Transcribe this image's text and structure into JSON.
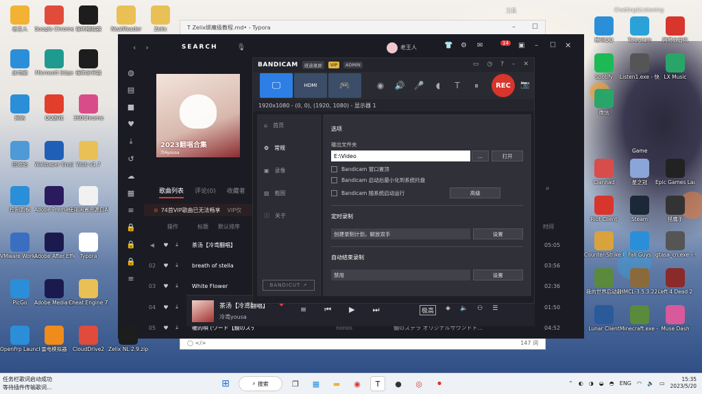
{
  "desktop": {
    "left_icons": [
      {
        "label": "老王人",
        "color": "#f2b233"
      },
      {
        "label": "Google Chrome",
        "color": "#e14b3b"
      },
      {
        "label": "夜神模拟器",
        "color": "#1d1d1d"
      },
      {
        "label": "NeatReader",
        "color": "#e8c055"
      },
      {
        "label": "Zelix",
        "color": "#e8c055"
      },
      {
        "label": "此电脑",
        "color": "#2a8fd8"
      },
      {
        "label": "Microsoft Edge",
        "color": "#1f9a8f"
      },
      {
        "label": "夜神多开器",
        "color": "#1d1d1d"
      },
      {
        "label": "网络",
        "color": "#2a8fd8"
      },
      {
        "label": "QQ游戏",
        "color": "#e33d2b"
      },
      {
        "label": "360Chrome",
        "color": "#d94c8a"
      },
      {
        "label": "回收站",
        "color": "#4d9ad6"
      },
      {
        "label": "Wallpaper Engine: 壁",
        "color": "#1f5fb8"
      },
      {
        "label": "Wub v1.7",
        "color": "#e8c055"
      },
      {
        "label": "控制面板",
        "color": "#2a8fd8"
      },
      {
        "label": "Adobe Premiere Pro 2023",
        "color": "#2a1a5e"
      },
      {
        "label": "使用闲置资源自Alist...",
        "color": "#f1f1f1"
      },
      {
        "label": "VMware Workstation Pro",
        "color": "#3a6ec1"
      },
      {
        "label": "Adobe After Effects 2023",
        "color": "#1a1a4e"
      },
      {
        "label": "Typora",
        "color": "#ffffff"
      },
      {
        "label": "PicGo",
        "color": "#2a8fd8"
      },
      {
        "label": "Adobe Media Encoder...",
        "color": "#1a1a4e"
      },
      {
        "label": "Cheat Engine 7.5",
        "color": "#e8c055"
      },
      {
        "label": "OpenFrp Launcher",
        "color": "#2a8fd8"
      },
      {
        "label": "雷电模拟器",
        "color": "#f08c1a"
      },
      {
        "label": "CloudDrive2",
        "color": "#e14b3b"
      },
      {
        "label": "Zelix NL 2.9.zip",
        "color": "#1d1d1d"
      }
    ],
    "right_icons": [
      {
        "label": "腾讯QQ",
        "color": "#2a8fd8"
      },
      {
        "label": "Telegram",
        "color": "#2aa1d8"
      },
      {
        "label": "网易云音乐",
        "color": "#d8352c"
      },
      {
        "label": "Spotify",
        "color": "#1db954"
      },
      {
        "label": "Listen1.exe - 快捷方式",
        "color": "#555"
      },
      {
        "label": "LX Music",
        "color": "#2aa56a"
      },
      {
        "label": "微信",
        "color": "#2aa56a"
      },
      {
        "label": "Clannad",
        "color": "#d94c4c"
      },
      {
        "label": "星之冠",
        "color": "#8aa6d8"
      },
      {
        "label": "Epic Games Launcher",
        "color": "#222"
      },
      {
        "label": "Riot Client",
        "color": "#d8352c"
      },
      {
        "label": "Steam",
        "color": "#1b2838"
      },
      {
        "label": "猎鹰手",
        "color": "#333"
      },
      {
        "label": "Counter-Strike Global...",
        "color": "#d8a23c"
      },
      {
        "label": "Fall Guys",
        "color": "#2a8fd8"
      },
      {
        "label": "gtasa_cn.exe - 快捷方式",
        "color": "#555"
      },
      {
        "label": "我的世界启动器",
        "color": "#5a8a3c"
      },
      {
        "label": "HMCL-3.5.3.224.exe -...",
        "color": "#8a6a3c"
      },
      {
        "label": "Left 4 Dead 2",
        "color": "#8a2a2a"
      },
      {
        "label": "Lunar Client",
        "color": "#2a5a9a"
      },
      {
        "label": "Minecraft.exe - 快捷方式",
        "color": "#5a8a3c"
      },
      {
        "label": "Muse Dash",
        "color": "#d85a9a"
      }
    ],
    "folder_top": "工具",
    "folder_top2": "Chatting&Listening",
    "game_folder": "Game"
  },
  "typora": {
    "title": "Zelix绑魔级教程.md• - Typora",
    "footer_left": "◯   </>",
    "footer_right": "147 词"
  },
  "music": {
    "search": "SEARCH",
    "user": "老王人",
    "badge": "14",
    "cover_title": "2023翻唱合集",
    "cover_sub": "冷Ayousa",
    "tabs": [
      "歌曲列表",
      "评论(0)",
      "收藏者"
    ],
    "vip_notice": "74首VIP歌曲已无法畅享",
    "vip_suffix": "VIP仅",
    "col_ops": "操作",
    "col_title": "标题",
    "col_sort": "默认排序",
    "col_time": "时间",
    "rows": [
      {
        "num": "",
        "title": "茶汤【冷鸢翻唱】",
        "artist": "",
        "album": "",
        "dur": "05:05"
      },
      {
        "num": "02",
        "title": "breath of stella",
        "artist": "",
        "album": "",
        "dur": "03:56"
      },
      {
        "num": "03",
        "title": "White Flower",
        "artist": "",
        "album": "",
        "dur": "02:36"
      },
      {
        "num": "04",
        "title": "",
        "artist": "",
        "album": "",
        "dur": "01:50"
      },
      {
        "num": "05",
        "title": "暖的唄 (ワード【鏡のステラ】挿入歌)",
        "artist": "nonos",
        "album": "鏡のステラ オリジナルサウンドト...",
        "dur": "04:52"
      }
    ],
    "player": {
      "title": "茶汤【冷鸢翻唱】",
      "artist": "冷鸢yousa",
      "quality": "极高"
    }
  },
  "bandicam": {
    "brand": "BANDICAM",
    "badge1": "班迪录屏",
    "badge_vip": "VIP",
    "badge_admin": "ADMIN",
    "rec": "REC",
    "hdmi": "HDMI",
    "resolution": "1920x1080 - (0, 0), (1920, 1080) - 显示器 1",
    "nav": [
      "首页",
      "常规",
      "录像",
      "截图",
      "关于"
    ],
    "bandicut": "BANDICUT ↗",
    "panel": {
      "heading": "选项",
      "output_label": "输出文件夹",
      "output_value": "E:\\Video",
      "dots": "...",
      "open": "打开",
      "checks": [
        "Bandicam 窗口置顶",
        "Bandicam 启动后最小化到系统托盘",
        "Bandicam 随系统启动运行"
      ],
      "advanced": "高级",
      "timer_heading": "定时录制",
      "timer_value": "创建录制计划，解放双手",
      "timer_btn": "设置",
      "auto_heading": "自动结束录制",
      "auto_value": "禁用",
      "auto_btn": "设置"
    }
  },
  "taskbar": {
    "notify1": "任务栏歌词启动成功",
    "notify2": "等待插件传输歌词...",
    "search": "搜索",
    "lang": "ENG",
    "time": "15:35",
    "date": "2023/5/20"
  }
}
